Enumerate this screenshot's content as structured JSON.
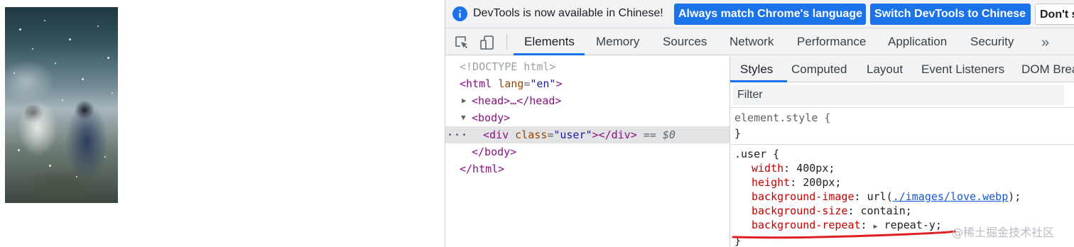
{
  "preview": {
    "image_alt": "background image of two figures in falling snow"
  },
  "infobar": {
    "message": "DevTools is now available in Chinese!",
    "match_button": "Always match Chrome's language",
    "switch_button": "Switch DevTools to Chinese",
    "dont_button": "Don't s"
  },
  "toolbar": {
    "tabs": [
      "Elements",
      "Memory",
      "Sources",
      "Network",
      "Performance",
      "Application",
      "Security"
    ],
    "active_tab": "Elements",
    "more_label": "»"
  },
  "tree": {
    "doctype": "<!DOCTYPE html>",
    "html_open_tag": "<html",
    "html_attr": "lang",
    "html_attr_val": "\"en\"",
    "html_open_close": ">",
    "head_line": "<head>…</head>",
    "body_open": "<body>",
    "div_open": "<div",
    "div_attr": "class",
    "div_attr_val": "\"user\"",
    "div_rest": "></div>",
    "selected_marker": "==",
    "selected_var": "$0",
    "dots": "···",
    "body_close": "</body>",
    "html_close": "</html>"
  },
  "styles": {
    "tabs": [
      "Styles",
      "Computed",
      "Layout",
      "Event Listeners",
      "DOM Brea"
    ],
    "active_tab": "Styles",
    "filter_placeholder": "Filter",
    "element_selector": "element.style {",
    "close_brace": "}",
    "user_selector": ".user {",
    "properties": [
      {
        "name": "width",
        "value": "400px;"
      },
      {
        "name": "height",
        "value": "200px;"
      },
      {
        "name": "background-image",
        "value_prefix": "url(",
        "link": "./images/love.webp",
        "value_suffix": ");"
      },
      {
        "name": "background-size",
        "value": "contain;"
      },
      {
        "name": "background-repeat",
        "value": "repeat-y;"
      }
    ]
  },
  "watermark": "@稀土掘金技术社区",
  "colors": {
    "accent": "#1a73e8",
    "tag": "#881280",
    "attribute": "#994500",
    "attribute_value": "#1a1aa6",
    "css_property": "#c80000",
    "annotation": "#e02020"
  }
}
